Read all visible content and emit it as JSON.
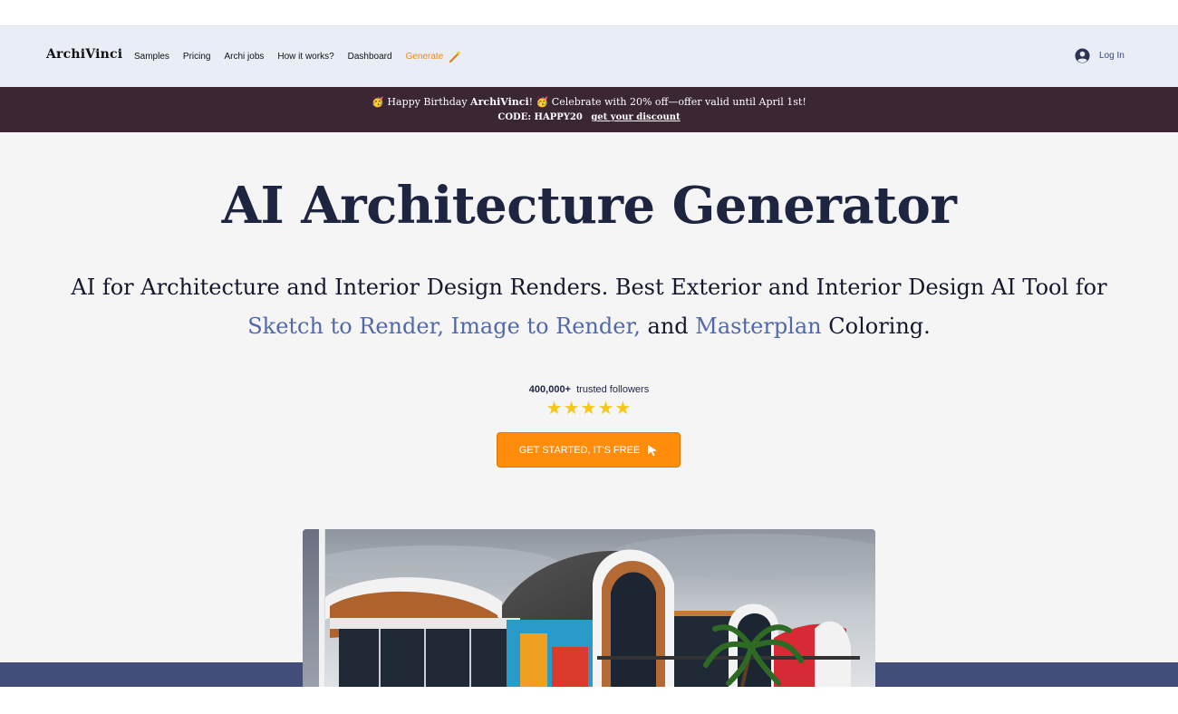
{
  "navbar": {
    "logo": "ArchiVinci",
    "links": [
      "Samples",
      "Pricing",
      "Archi jobs",
      "How it works?",
      "Dashboard"
    ],
    "generate_label": "Generate",
    "login_label": "Log In"
  },
  "promo": {
    "emoji": "🥳",
    "line1_before": "Happy Birthday ",
    "line1_brand": "ArchiVinci",
    "line1_after": "! ",
    "line1_rest": " Celebrate with 20% off—offer valid until April 1st!",
    "code_text": "CODE: HAPPY20",
    "discount_link": "get your discount"
  },
  "hero": {
    "title": "AI Architecture Generator",
    "subtitle_part1": "AI for Architecture and Interior Design Renders. Best Exterior and Interior Design AI Tool for ",
    "subtitle_hl1": "Sketch to Render, Image to Render,",
    "subtitle_part2": " and ",
    "subtitle_hl2": "Masterplan",
    "subtitle_part3": " Coloring.",
    "followers_count": "400,000+",
    "followers_label": "trusted followers",
    "stars": "★★★★★",
    "cta_label": "GET STARTED, IT'S FREE"
  },
  "colors": {
    "accent": "#ff8c0a",
    "promo_bg": "#3b2634",
    "highlight": "#5268a8",
    "band": "#434d7a",
    "star": "#f6c71b"
  },
  "icons": {
    "generate": "magic-wand-icon",
    "login": "user-avatar-icon",
    "cta": "cursor-arrow-icon"
  }
}
